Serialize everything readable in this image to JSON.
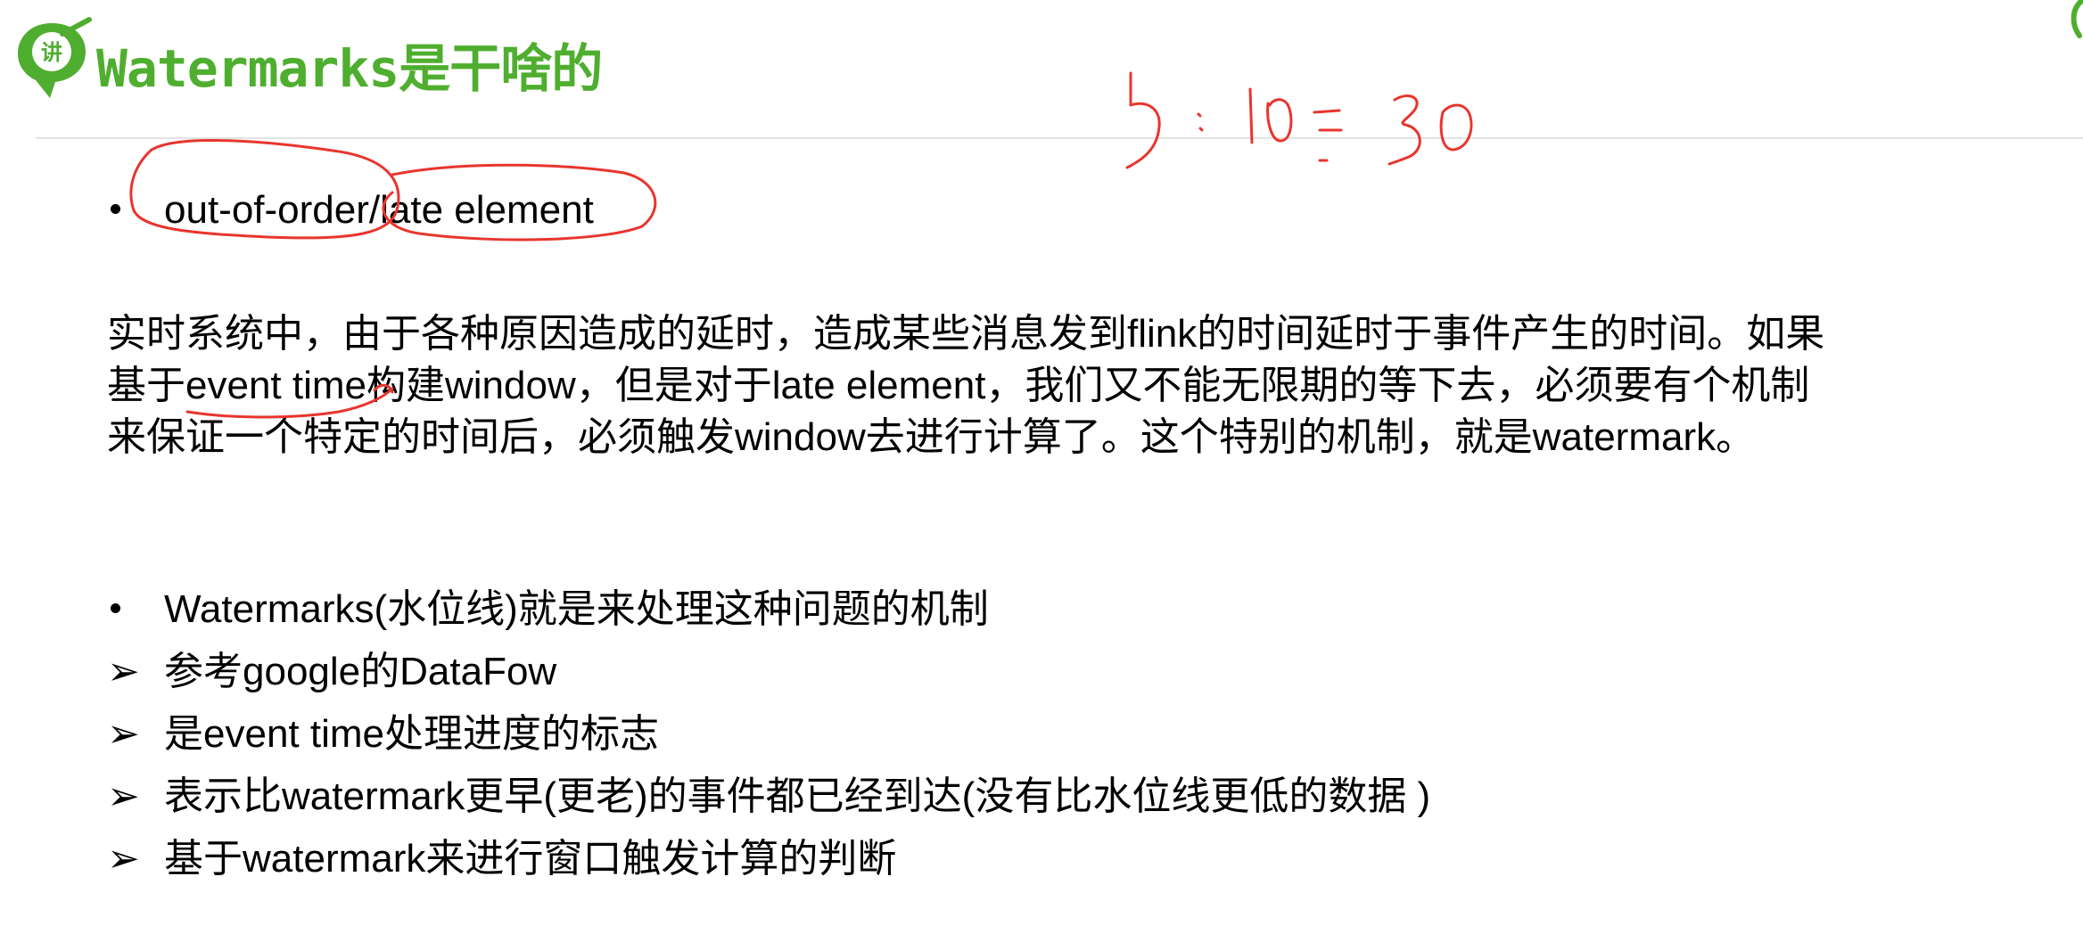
{
  "slide": {
    "title": "Watermarks是干啥的",
    "logo_text": "讲",
    "logo_icon": "speech-bubble-check-icon",
    "accent_color": "#4fae2f",
    "annotation_color": "#e8352e",
    "first_bullet": "out-of-order/late element",
    "paragraph_lines": [
      "实时系统中，由于各种原因造成的延时，造成某些消息发到flink的时间延时于事件产生的时间。如果",
      "基于event time构建window，但是对于late element，我们又不能无限期的等下去，必须要有个机制",
      "来保证一个特定的时间后，必须触发window去进行计算了。这个特别的机制，就是watermark。"
    ],
    "second_bullet": "Watermarks(水位线)就是来处理这种问题的机制",
    "sub_items": [
      "参考google的DataFow",
      "是event time处理进度的标志",
      "表示比watermark更早(更老)的事件都已经到达(没有比水位线更低的数据 )",
      "基于watermark来进行窗口触发计算的判断"
    ],
    "sub_bullet_glyph": "➢",
    "handwriting": "5:10:30"
  }
}
